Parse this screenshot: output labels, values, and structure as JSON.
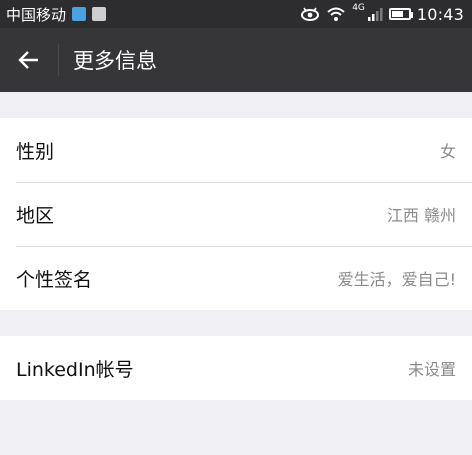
{
  "status_bar": {
    "carrier": "中国移动",
    "network": "4G",
    "time": "10:43"
  },
  "navbar": {
    "title": "更多信息"
  },
  "profile_info": {
    "items": [
      {
        "label": "性别",
        "value": "女"
      },
      {
        "label": "地区",
        "value": "江西 赣州"
      },
      {
        "label": "个性签名",
        "value": "爱生活，爱自己!"
      }
    ]
  },
  "linkedin": {
    "label": "LinkedIn帐号",
    "value": "未设置"
  },
  "icons": {
    "back": "arrow-left-icon",
    "status": [
      "app-notification-icon",
      "image-notification-icon",
      "eye-icon",
      "wifi-icon",
      "signal-icon",
      "battery-icon"
    ]
  },
  "colors": {
    "navbar": "#363638",
    "status_bar": "#2d2d30",
    "background": "#efeff4"
  }
}
